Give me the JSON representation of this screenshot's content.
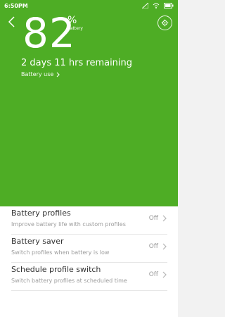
{
  "status_bar": {
    "time": "6:50PM"
  },
  "battery": {
    "percent": "82",
    "percent_sign": "%",
    "percent_word": "battery",
    "remaining": "2 days 11 hrs remaining",
    "battery_use_link": "Battery use"
  },
  "settings": [
    {
      "title": "Battery profiles",
      "subtitle": "Improve battery life with custom profiles",
      "value": "Off"
    },
    {
      "title": "Battery saver",
      "subtitle": "Switch profiles when battery is low",
      "value": "Off"
    },
    {
      "title": "Schedule profile switch",
      "subtitle": "Switch battery profiles at scheduled time",
      "value": "Off"
    }
  ],
  "icons": [
    "back-arrow-icon",
    "settings-gear-icon",
    "chevron-right-icon",
    "signal-icon",
    "wifi-icon",
    "battery-icon"
  ],
  "colors": {
    "hero": "#4ead25",
    "background": "#f2f2f2",
    "list": "#ffffff"
  }
}
